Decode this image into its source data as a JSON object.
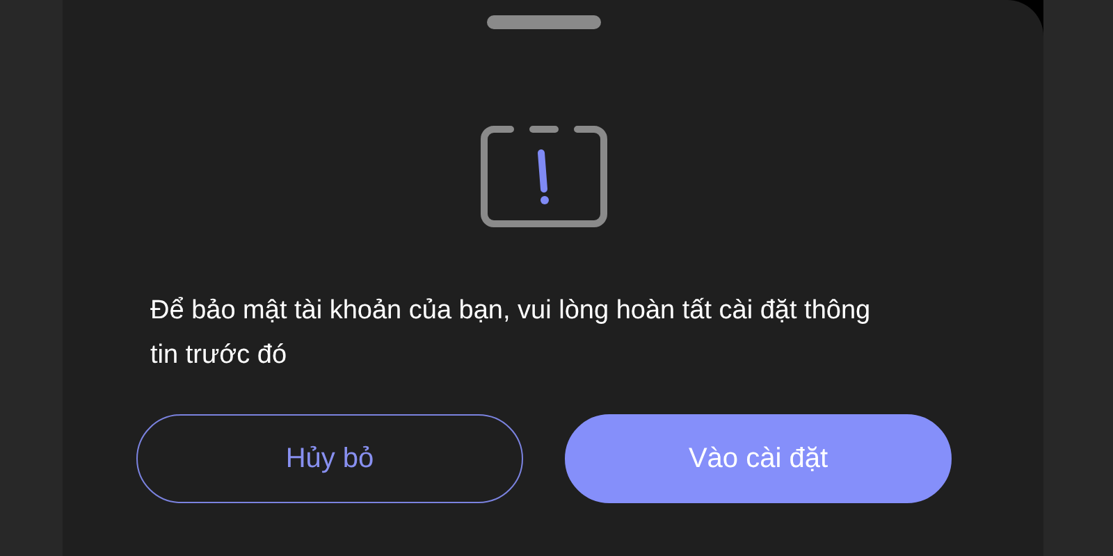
{
  "message": "Để bảo mật tài khoản của bạn, vui lòng hoàn tất cài đặt thông tin trước đó",
  "buttons": [
    {
      "label": "Hủy bỏ",
      "kind": "secondary"
    },
    {
      "label": "Vào cài đặt",
      "kind": "primary"
    }
  ]
}
